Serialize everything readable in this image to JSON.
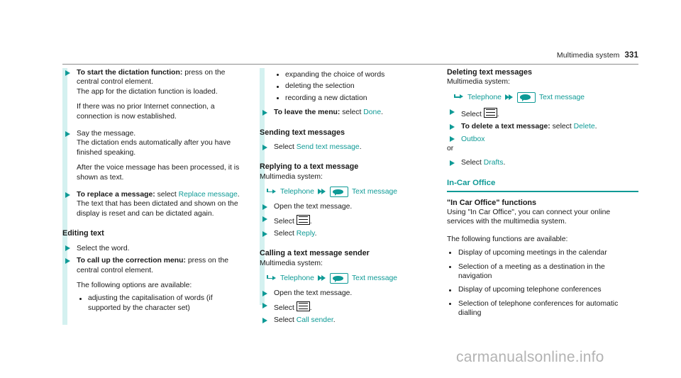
{
  "header": {
    "chapter": "Multimedia system",
    "page_number": "331"
  },
  "watermark": "carmanualsonline.info",
  "colors": {
    "accent_teal": "#0e9a96",
    "margin_bar": "#d4f1f0",
    "text": "#1a1a1a",
    "watermark": "#b3b3b3"
  },
  "column1": {
    "step_start_dictation": {
      "bold": "To start the dictation function:",
      "rest": " press on the central control element.",
      "line2": "The app for the dictation function is loaded.",
      "line3": "If there was no prior Internet connection, a connection is now established."
    },
    "step_say_message": {
      "text": "Say the message.",
      "line2": "The dictation ends automatically after you have finished speaking.",
      "line3": "After the voice message has been processed, it is shown as text."
    },
    "step_replace_message": {
      "bold": "To replace a message:",
      "rest": " select ",
      "link": "Replace message",
      "period": ".",
      "line2": "The text that has been dictated and shown on the display is reset and can be dictated again."
    },
    "heading_editing_text": "Editing text",
    "step_select_word": "Select the word.",
    "step_correction_menu": {
      "bold": "To call up the correction menu:",
      "rest": " press on the central control element.",
      "line2": "The following options are available:"
    },
    "option_capitalisation": "adjusting the capitalisation of words (if supported by the character set)"
  },
  "column2": {
    "options": [
      "expanding the choice of words",
      "deleting the selection",
      "recording a new dictation"
    ],
    "step_leave_menu": {
      "bold": "To leave the menu:",
      "rest": " select ",
      "link": "Done",
      "period": "."
    },
    "heading_sending": "Sending text messages",
    "step_send": {
      "prefix": "Select ",
      "link": "Send text message",
      "period": "."
    },
    "heading_replying": "Replying to a text message",
    "multimedia_label_1": "Multimedia system:",
    "navpath_1": {
      "item1": "Telephone",
      "item2": "Text message",
      "enter_icon": "enter-arrow-icon",
      "separator_icon": "double-arrow-icon",
      "message_icon": "text-message-icon"
    },
    "step_open_1": "Open the text message.",
    "step_select_list_1": {
      "prefix": "Select ",
      "icon": "list-menu-icon",
      "period": "."
    },
    "step_reply": {
      "prefix": "Select ",
      "link": "Reply",
      "period": "."
    },
    "heading_calling": "Calling a text message sender",
    "multimedia_label_2": "Multimedia system:",
    "navpath_2": {
      "item1": "Telephone",
      "item2": "Text message",
      "enter_icon": "enter-arrow-icon",
      "separator_icon": "double-arrow-icon",
      "message_icon": "text-message-icon"
    },
    "step_open_2": "Open the text message.",
    "step_select_list_2": {
      "prefix": "Select ",
      "icon": "list-menu-icon",
      "period": "."
    },
    "step_call_sender": {
      "prefix": "Select ",
      "link": "Call sender",
      "period": "."
    }
  },
  "column3": {
    "heading_deleting": "Deleting text messages",
    "multimedia_label": "Multimedia system:",
    "navpath": {
      "item1": "Telephone",
      "item2": "Text message",
      "enter_icon": "enter-arrow-icon",
      "separator_icon": "double-arrow-icon",
      "message_icon": "text-message-icon"
    },
    "step_select_list": {
      "prefix": "Select ",
      "icon": "list-menu-icon",
      "period": "."
    },
    "step_delete": {
      "bold": "To delete a text message:",
      "rest": " select ",
      "link": "Delete",
      "period": "."
    },
    "step_outbox": {
      "link": "Outbox"
    },
    "or_text": "or",
    "step_drafts": {
      "prefix": "Select ",
      "link": "Drafts",
      "period": "."
    },
    "section_heading": "In-Car Office",
    "heading_functions": "\"In Car Office\" functions",
    "intro": "Using \"In Car Office\", you can connect your online services with the multimedia system.",
    "available_label": "The following functions are available:",
    "functions": [
      "Display of upcoming meetings in the calendar",
      "Selection of a meeting as a destination in the navigation",
      "Display of upcoming telephone conferences",
      "Selection of telephone conferences for automatic dialling"
    ]
  }
}
